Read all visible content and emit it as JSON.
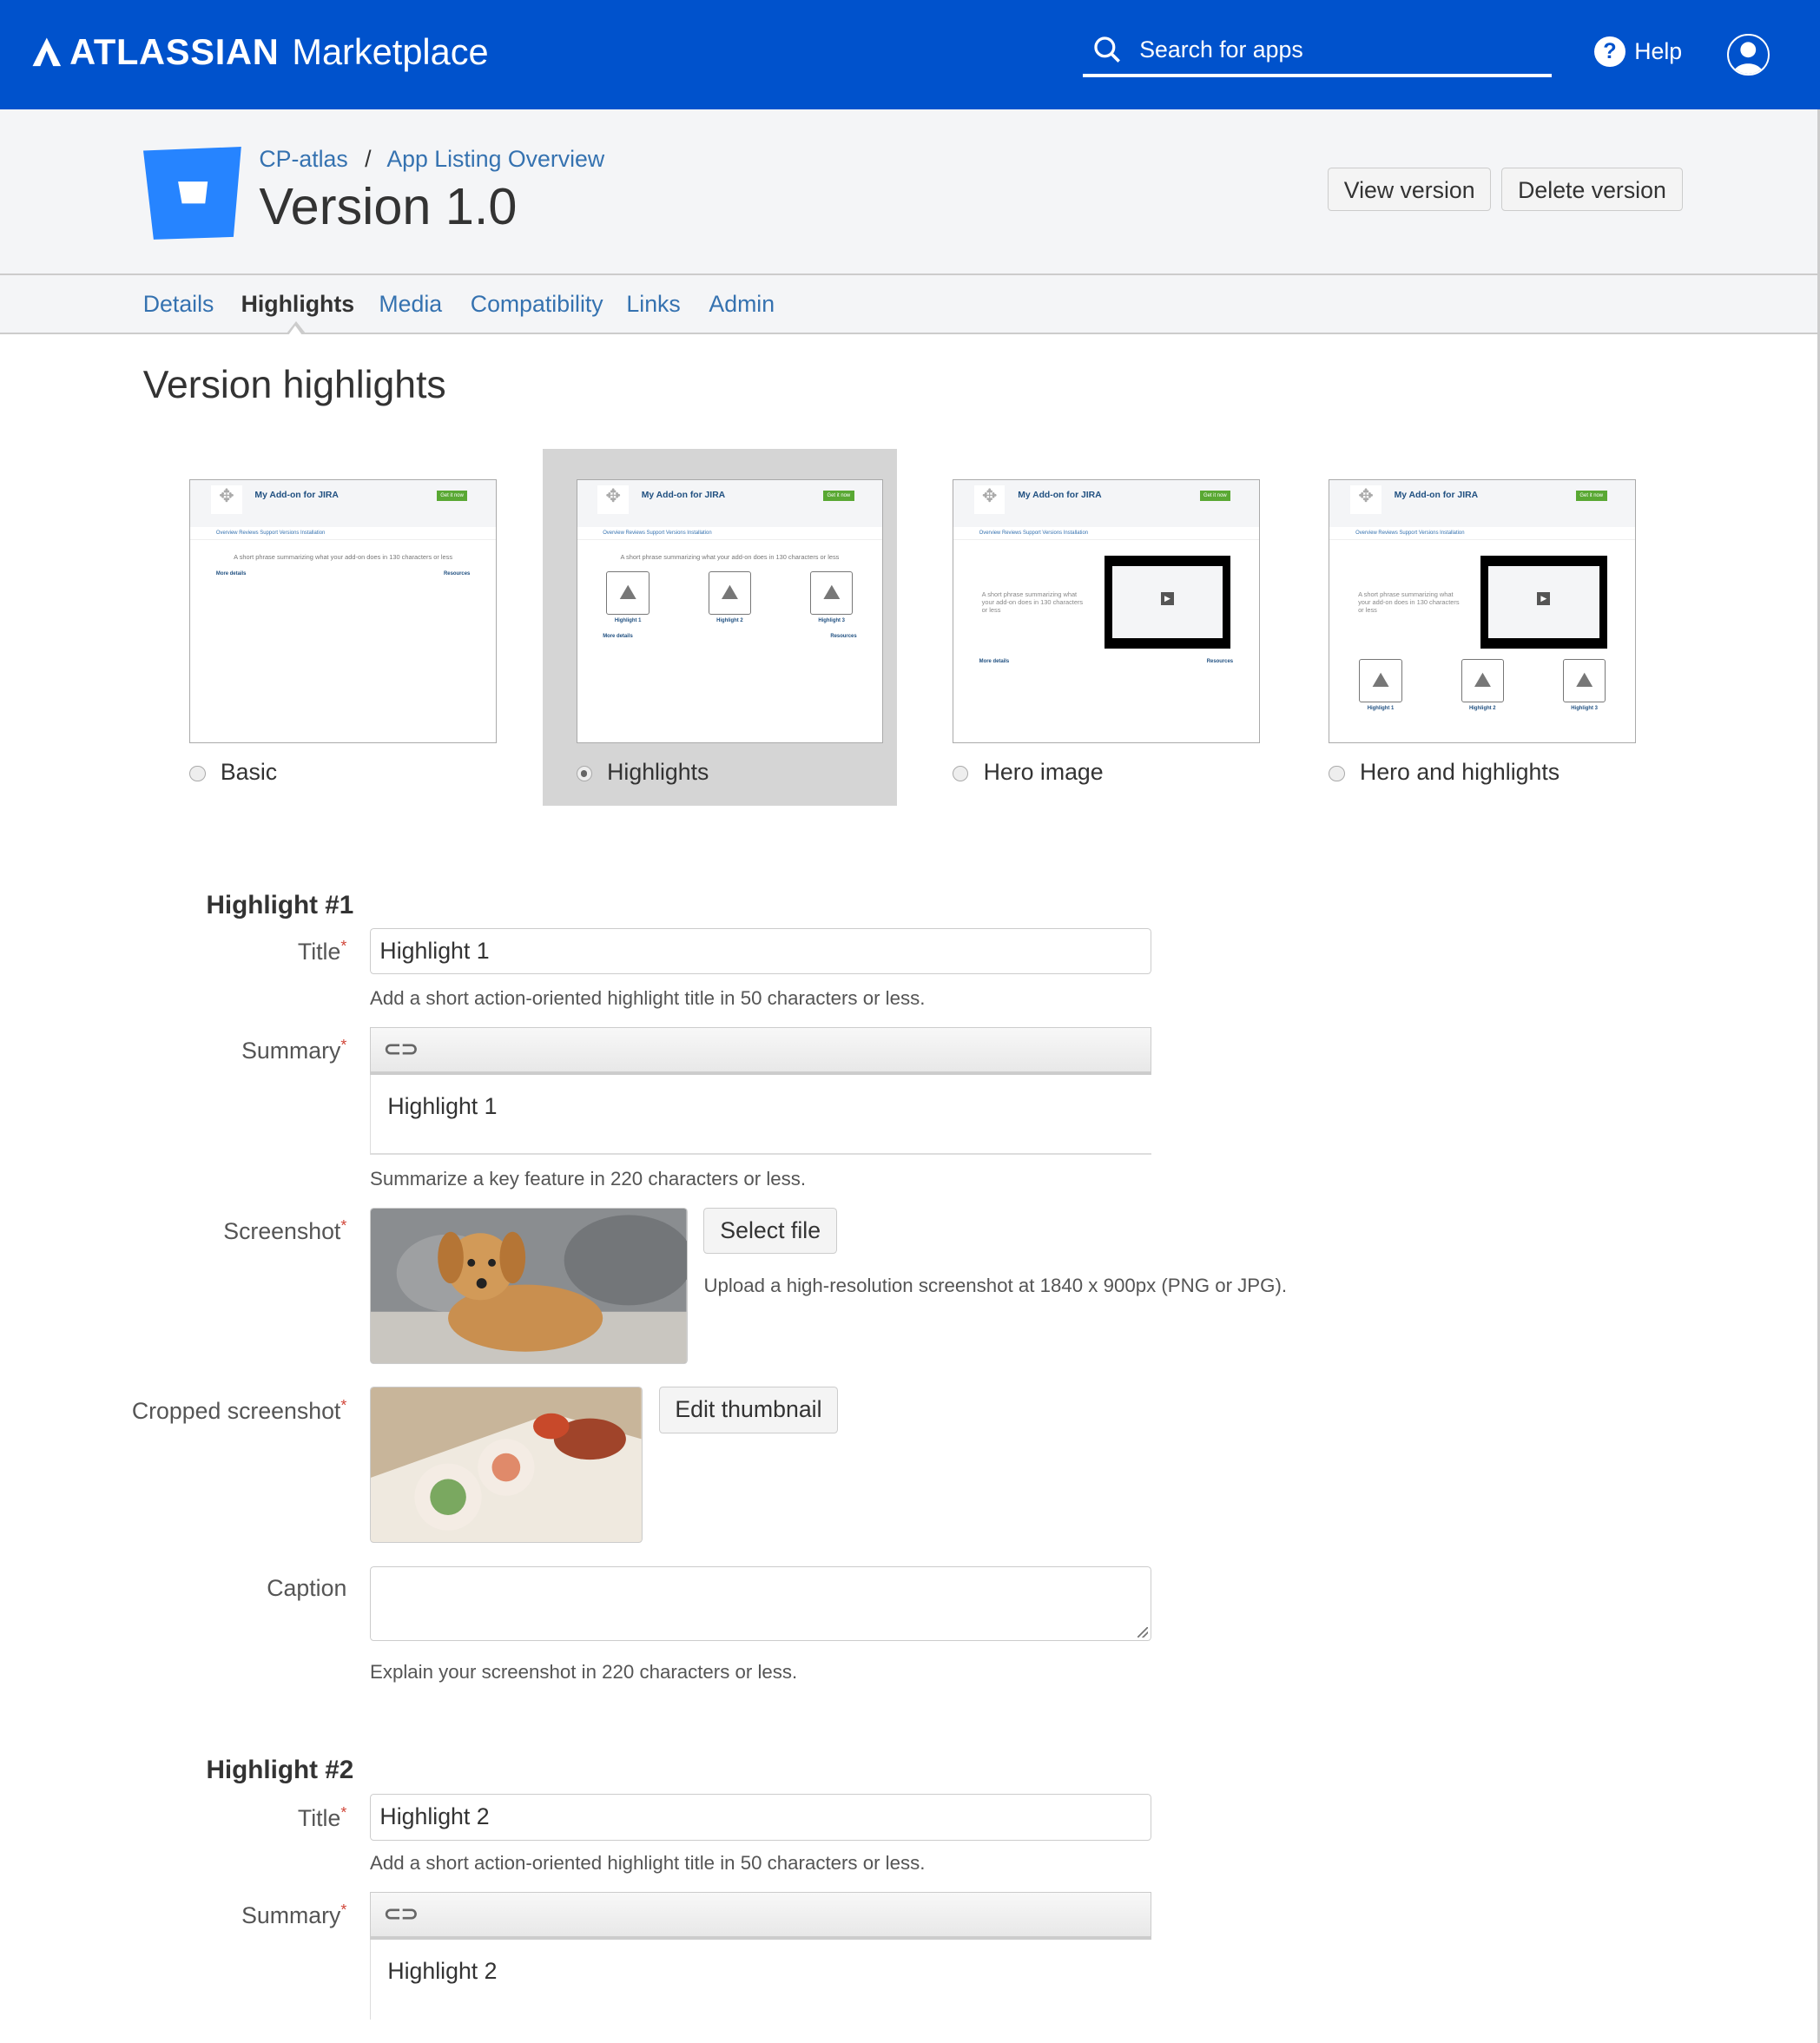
{
  "topbar": {
    "brand": "ATLASSIAN",
    "product": "Marketplace",
    "search_placeholder": "Search for apps",
    "help": "Help",
    "color": "#0052cc"
  },
  "header": {
    "breadcrumb": [
      "CP-atlas",
      "App Listing Overview"
    ],
    "separator": "/",
    "title": "Version 1.0",
    "buttons": {
      "view": "View version",
      "delete": "Delete version"
    }
  },
  "tabs": [
    {
      "label": "Details"
    },
    {
      "label": "Highlights",
      "active": true
    },
    {
      "label": "Media"
    },
    {
      "label": "Compatibility"
    },
    {
      "label": "Links"
    },
    {
      "label": "Admin"
    }
  ],
  "section_title": "Version highlights",
  "thumb": {
    "app": "My Add-on for JIRA",
    "get": "Get it now",
    "nav": "Overview  Reviews  Support  Versions  Installation",
    "tagline": "A short phrase summarizing what your add-on does in 130 characters or less",
    "highlights": [
      "Highlight 1",
      "Highlight 2",
      "Highlight 3"
    ],
    "more": "More details",
    "resources": "Resources"
  },
  "layouts": [
    {
      "label": "Basic",
      "selected": false
    },
    {
      "label": "Highlights",
      "selected": true
    },
    {
      "label": "Hero image",
      "selected": false
    },
    {
      "label": "Hero and highlights",
      "selected": false
    }
  ],
  "highlight1": {
    "heading": "Highlight #1",
    "title_label": "Title",
    "title_value": "Highlight 1",
    "title_hint": "Add a short action-oriented highlight title in 50 characters or less.",
    "summary_label": "Summary",
    "summary_value": "Highlight 1",
    "summary_hint": "Summarize a key feature in 220 characters or less.",
    "screenshot_label": "Screenshot",
    "select_file": "Select file",
    "screenshot_hint": "Upload a high-resolution screenshot at 1840 x 900px (PNG or JPG).",
    "cropped_label": "Cropped screenshot",
    "edit_thumbnail": "Edit thumbnail",
    "caption_label": "Caption",
    "caption_value": "",
    "caption_hint": "Explain your screenshot in 220 characters or less."
  },
  "highlight2": {
    "heading": "Highlight #2",
    "title_label": "Title",
    "title_value": "Highlight 2",
    "title_hint": "Add a short action-oriented highlight title in 50 characters or less.",
    "summary_label": "Summary",
    "summary_value": "Highlight 2"
  },
  "required_mark": "*",
  "link_icon": "⊖"
}
